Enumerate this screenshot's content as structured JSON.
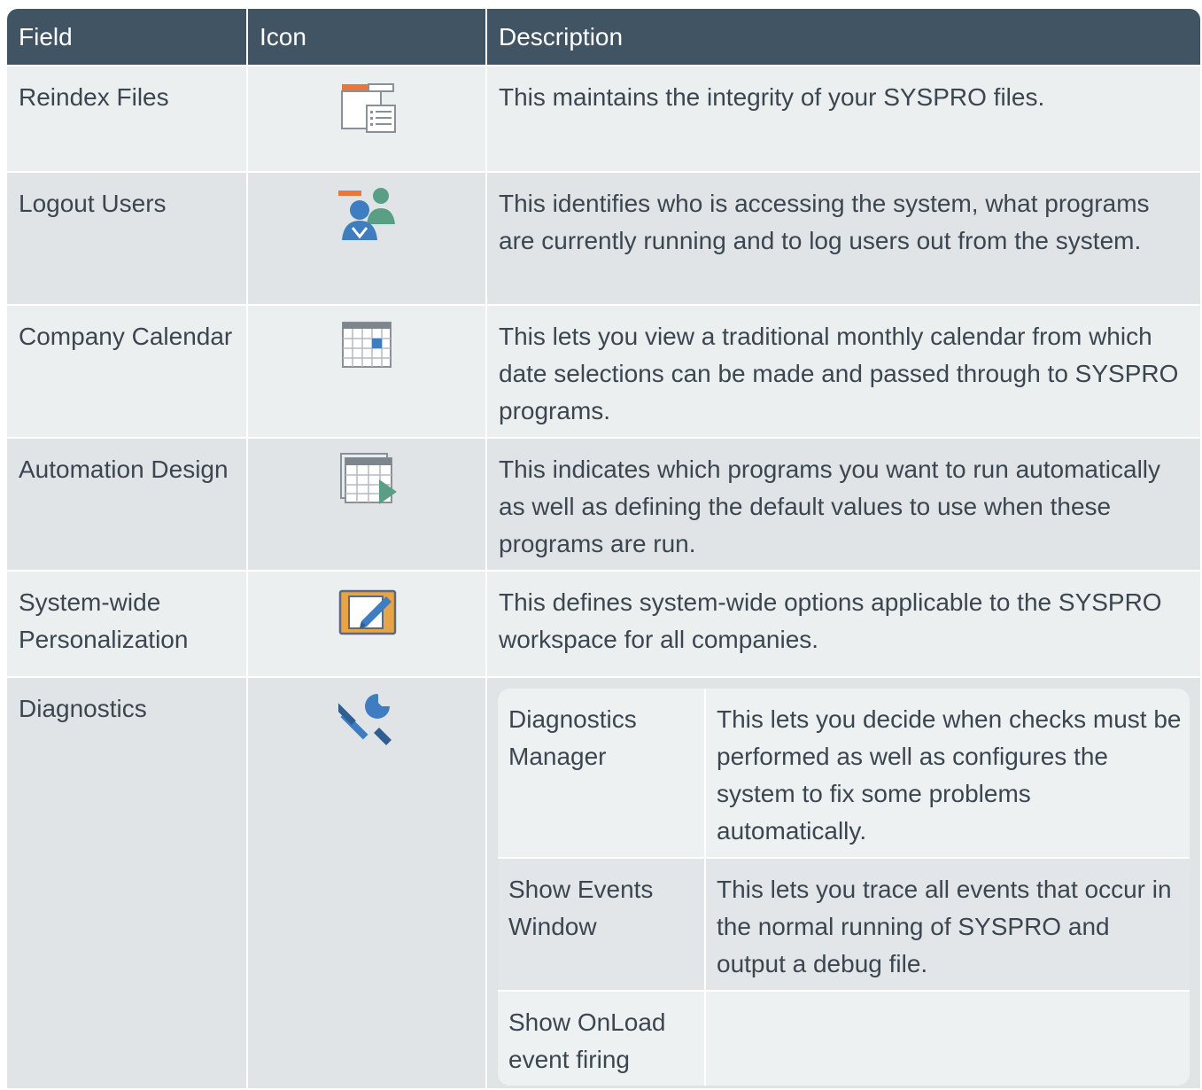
{
  "header": {
    "field": "Field",
    "icon": "Icon",
    "description": "Description"
  },
  "rows": [
    {
      "field": "Reindex Files",
      "icon": "reindex-files-icon",
      "description": "This maintains the integrity of your SYSPRO files."
    },
    {
      "field": "Logout Users",
      "icon": "logout-users-icon",
      "description": "This identifies who is accessing the system, what programs are currently running and to log users out from the system."
    },
    {
      "field": "Company Calendar",
      "icon": "calendar-icon",
      "description": "This lets you view a traditional monthly calendar from which date selections can be made and passed through to SYSPRO programs."
    },
    {
      "field": "Automation Design",
      "icon": "automation-design-icon",
      "description": "This indicates which programs you want to run automatically as well as defining the default values to use when these programs are run."
    },
    {
      "field": "System-wide Personalization",
      "icon": "personalization-icon",
      "description": "This defines system-wide options applicable to the SYSPRO workspace for all companies."
    },
    {
      "field": "Diagnostics",
      "icon": "tools-icon",
      "subrows": [
        {
          "name": "Diagnostics Manager",
          "description": "This lets you decide when checks must be performed as well as configures the system to fix some problems automatically."
        },
        {
          "name": "Show Events Window",
          "description": "This lets you trace all events that occur in the normal running of SYSPRO and output a debug file."
        },
        {
          "name": "Show OnLoad event firing",
          "description": ""
        }
      ]
    }
  ],
  "colors": {
    "header_bg": "#415464",
    "row_light": "#eceff0",
    "row_dark": "#e1e4e6",
    "icon_blue": "#3d7dc0",
    "icon_orange": "#e8773a",
    "icon_green": "#5a9e86"
  }
}
